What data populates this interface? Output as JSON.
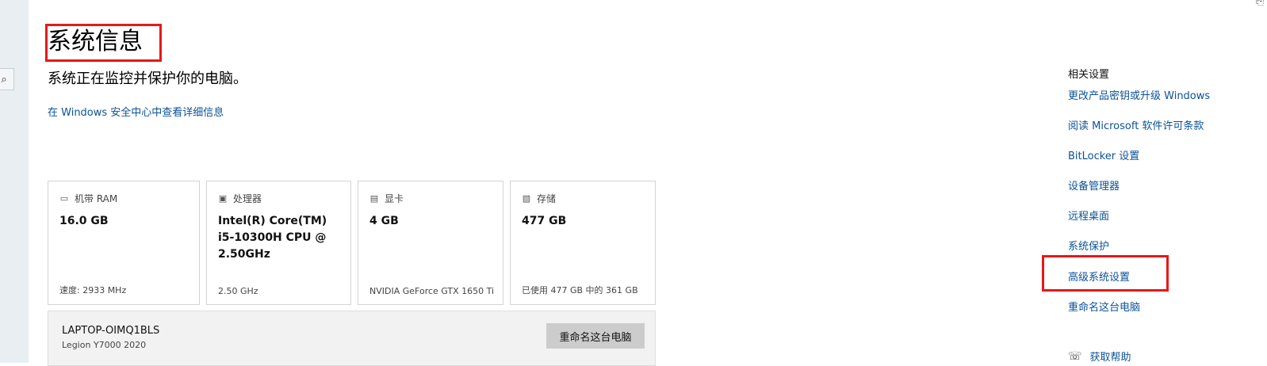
{
  "title": "系统信息",
  "status_text": "系统正在监控并保护你的电脑。",
  "security_link": "在 Windows 安全中心中查看详细信息",
  "cards": [
    {
      "label": "机带 RAM",
      "icon": "memory-icon",
      "value": "16.0 GB",
      "footer": "速度: 2933 MHz"
    },
    {
      "label": "处理器",
      "icon": "processor-icon",
      "value": "Intel(R) Core(TM) i5-10300H CPU @ 2.50GHz",
      "footer": "2.50 GHz"
    },
    {
      "label": "显卡",
      "icon": "graphics-card-icon",
      "value": "4 GB",
      "footer": "NVIDIA GeForce GTX 1650 Ti"
    },
    {
      "label": "存储",
      "icon": "storage-icon",
      "value": "477 GB",
      "footer": "已使用 477 GB 中的 361 GB"
    }
  ],
  "device": {
    "name": "LAPTOP-OIMQ1BLS",
    "model": "Legion Y7000 2020",
    "rename_button": "重命名这台电脑"
  },
  "related": {
    "title": "相关设置",
    "links": [
      "更改产品密钥或升级 Windows",
      "阅读 Microsoft 软件许可条款",
      "BitLocker 设置",
      "设备管理器",
      "远程桌面",
      "系统保护",
      "高级系统设置",
      "重命名这台电脑"
    ]
  },
  "help": {
    "label": "获取帮助"
  },
  "colors": {
    "link": "#0b5296",
    "highlight": "#e81818"
  }
}
